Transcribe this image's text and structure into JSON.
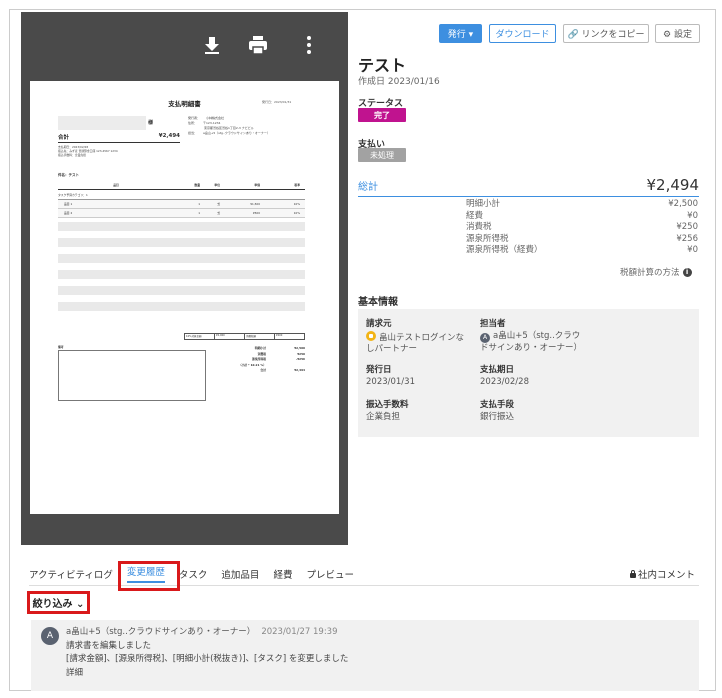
{
  "viewer": {
    "document": {
      "title": "支払明細書",
      "number": "発行日：2023/01/31",
      "sama": "様",
      "issuer": [
        [
          "発行者：",
          "小林株式会社"
        ],
        [
          "住所：",
          "〒123-1234"
        ],
        [
          "",
          "東京都渋谷区渋谷1丁目2-3 ナビビル"
        ],
        [
          "担当：",
          "a畠山+5（stg..クラウドサインあり・オーナー）"
        ]
      ],
      "total_label": "合計",
      "total_value": "¥2,494",
      "meta_lines": [
        "支払期日：2023/02/28",
        "振込先：みずほ 普通預金口座 123-4567 1234",
        "振込手数料：企業負担"
      ],
      "subject": "件名：テスト",
      "table_headers": [
        "品目",
        "数量",
        "単位",
        "単価",
        "税率"
      ],
      "category": "タスク予算カテゴリ：1",
      "rows": [
        [
          "品目 1",
          "1",
          "式",
          "¥1,500",
          "10%"
        ],
        [
          "品目 2",
          "1",
          "式",
          "¥500",
          "10%"
        ]
      ],
      "tax_cells": [
        "10%対象金額",
        "¥2,000",
        "消費税額",
        "¥200"
      ],
      "bikou": "備考",
      "sums": [
        [
          "明細小計",
          "¥2,500"
        ],
        [
          "消費税",
          "¥250"
        ],
        [
          "源泉所得税",
          "-¥256"
        ],
        [
          "（小計 * 10.21 %）",
          ""
        ],
        [
          "合計",
          "¥2,494"
        ]
      ]
    }
  },
  "actions": {
    "issue": "発行 ▾",
    "download": "ダウンロード",
    "copy_link": "🔗 リンクをコピー",
    "settings": "⚙ 設定"
  },
  "header": {
    "title": "テスト",
    "created": "作成日 2023/01/16"
  },
  "status": {
    "label": "ステータス",
    "value": "完了",
    "payment_label": "支払い",
    "payment_value": "未処理"
  },
  "total": {
    "label": "総計",
    "value": "¥2,494"
  },
  "breakdown": [
    {
      "label": "明細小計",
      "value": "¥2,500"
    },
    {
      "label": "経費",
      "value": "¥0"
    },
    {
      "label": "消費税",
      "value": "¥250"
    },
    {
      "label": "源泉所得税",
      "value": "¥256"
    },
    {
      "label": "源泉所得税（経費）",
      "value": "¥0"
    }
  ],
  "calc_method": "税額計算の方法",
  "basic": {
    "title": "基本情報",
    "requester_label": "請求元",
    "requester_value_1": "畠山テストログインな",
    "requester_value_2": "しパートナー",
    "assignee_label": "担当者",
    "assignee_value_1": "a畠山+5（stg..クラウ",
    "assignee_value_2": "ドサインあり・オーナー）",
    "issue_date_label": "発行日",
    "issue_date_value": "2023/01/31",
    "due_date_label": "支払期日",
    "due_date_value": "2023/02/28",
    "fee_label": "振込手数料",
    "fee_value": "企業負担",
    "method_label": "支払手段",
    "method_value": "銀行振込"
  },
  "tabs": [
    {
      "label": "アクティビティログ"
    },
    {
      "label": "変更履歴"
    },
    {
      "label": "タスク"
    },
    {
      "label": "追加品目"
    },
    {
      "label": "経費"
    },
    {
      "label": "プレビュー"
    }
  ],
  "internal_comment": "社内コメント",
  "filter": {
    "label": "絞り込み ⌄"
  },
  "history": {
    "avatar": "A",
    "author": "a畠山+5（stg..クラウドサインあり・オーナー）",
    "time": "2023/01/27 19:39",
    "line1": "請求書を編集しました",
    "line2": "[請求金額]、[源泉所得税]、[明細小計(税抜き)]、[タスク] を変更しました",
    "detail": "詳細"
  }
}
